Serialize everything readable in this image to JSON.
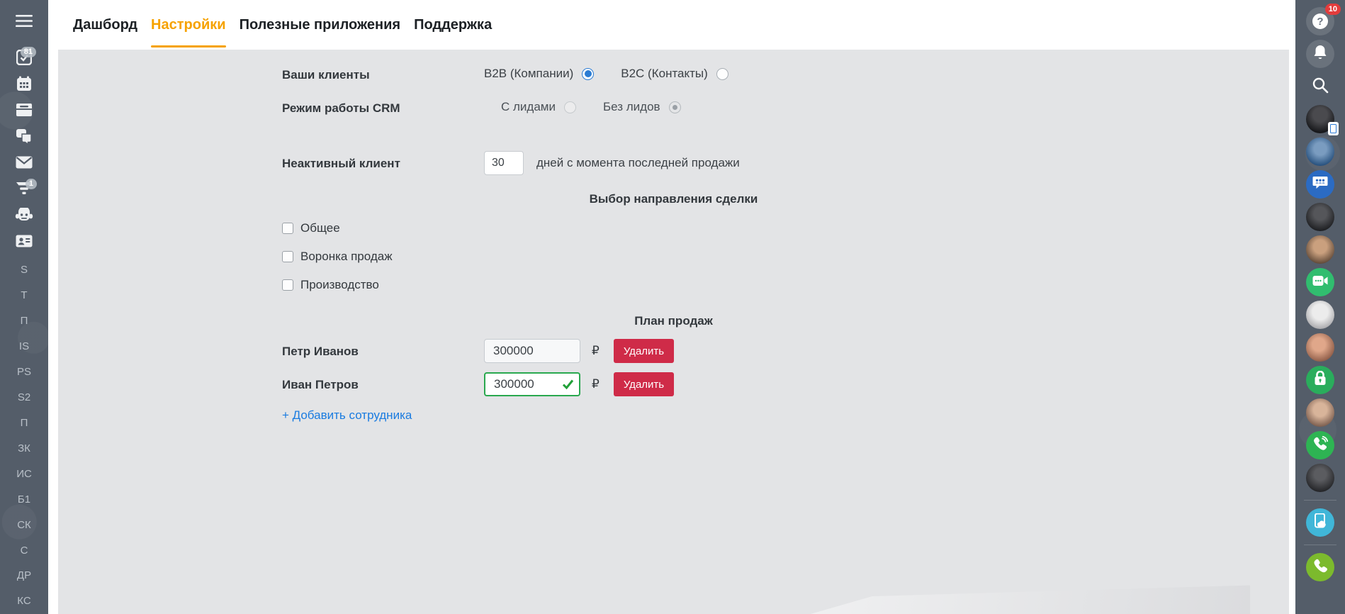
{
  "tabs": [
    {
      "label": "Дашборд",
      "active": false
    },
    {
      "label": "Настройки",
      "active": true
    },
    {
      "label": "Полезные приложения",
      "active": false
    },
    {
      "label": "Поддержка",
      "active": false
    }
  ],
  "left_sidebar": {
    "tasks_badge": "81",
    "crm_badge": "1",
    "workspaces": [
      "S",
      "T",
      "П",
      "IS",
      "PS",
      "S2",
      "П",
      "ЗК",
      "ИС",
      "Б1",
      "СК",
      "С",
      "ДР",
      "КС"
    ]
  },
  "right_sidebar": {
    "help_badge": "10"
  },
  "form": {
    "clients": {
      "label": "Ваши клиенты",
      "options": [
        {
          "label": "B2B (Компании)",
          "selected": true
        },
        {
          "label": "B2C (Контакты)",
          "selected": false
        }
      ]
    },
    "mode": {
      "label": "Режим работы CRM",
      "options": [
        {
          "label": "С лидами",
          "selected": false,
          "disabled": true
        },
        {
          "label": "Без лидов",
          "selected": true,
          "disabled": true
        }
      ]
    },
    "inactive": {
      "label": "Неактивный клиент",
      "value": "30",
      "suffix": "дней с момента последней продажи"
    },
    "deal_direction": {
      "title": "Выбор направления сделки",
      "options": [
        "Общее",
        "Воронка продаж",
        "Производство"
      ],
      "checked": [
        false,
        false,
        false
      ]
    },
    "sales_plan": {
      "title": "План продаж",
      "currency": "₽",
      "delete_label": "Удалить",
      "add_label": "+ Добавить сотрудника",
      "rows": [
        {
          "name": "Петр Иванов",
          "value": "300000",
          "confirmed": false
        },
        {
          "name": "Иван Петров",
          "value": "300000",
          "confirmed": true
        }
      ]
    }
  },
  "colors": {
    "accent_orange": "#f6a200",
    "delete_red": "#cf2b48",
    "confirm_green": "#2aa84f",
    "link_blue": "#1a7be0",
    "sidebar_dark": "#545d69",
    "panel_gray": "#e3e4e6"
  }
}
